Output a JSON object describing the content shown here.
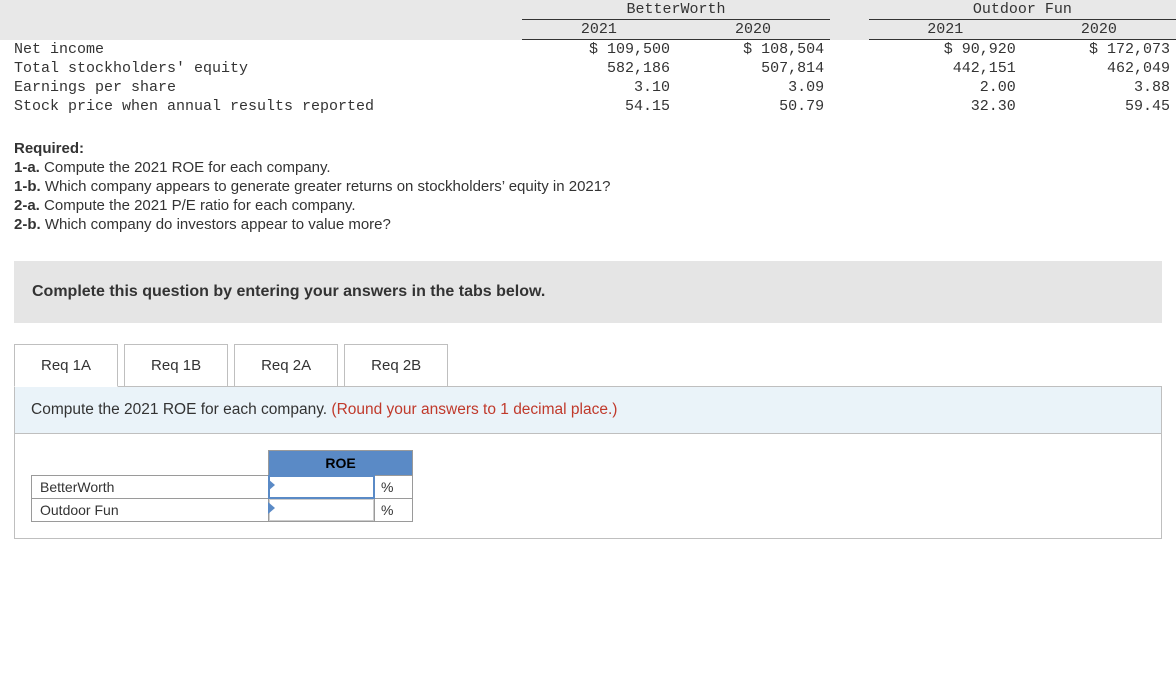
{
  "data_table": {
    "companies": [
      "BetterWorth",
      "Outdoor Fun"
    ],
    "years": [
      "2021",
      "2020",
      "2021",
      "2020"
    ],
    "rows": [
      {
        "label": "Net income",
        "c": [
          "$ 109,500",
          "$ 108,504",
          "$ 90,920",
          "$ 172,073"
        ]
      },
      {
        "label": "Total stockholders' equity",
        "c": [
          "582,186",
          "507,814",
          "442,151",
          "462,049"
        ]
      },
      {
        "label": "Earnings per share",
        "c": [
          "3.10",
          "3.09",
          "2.00",
          "3.88"
        ]
      },
      {
        "label": "Stock price when annual results reported",
        "c": [
          "54.15",
          "50.79",
          "32.30",
          "59.45"
        ]
      }
    ]
  },
  "required": {
    "heading": "Required:",
    "items": [
      {
        "num": "1-a.",
        "text": "Compute the 2021 ROE for each company."
      },
      {
        "num": "1-b.",
        "text": "Which company appears to generate greater returns on stockholders’ equity in 2021?"
      },
      {
        "num": "2-a.",
        "text": "Compute the 2021 P/E ratio for each company."
      },
      {
        "num": "2-b.",
        "text": "Which company do investors appear to value more?"
      }
    ]
  },
  "instruction": "Complete this question by entering your answers in the tabs below.",
  "tabs": [
    "Req 1A",
    "Req 1B",
    "Req 2A",
    "Req 2B"
  ],
  "active_tab": 0,
  "panel": {
    "prompt": "Compute the 2021 ROE for each company. ",
    "hint": "(Round your answers to 1 decimal place.)",
    "col_header": "ROE",
    "rows": [
      {
        "label": "BetterWorth",
        "value": "",
        "unit": "%"
      },
      {
        "label": "Outdoor Fun",
        "value": "",
        "unit": "%"
      }
    ]
  }
}
